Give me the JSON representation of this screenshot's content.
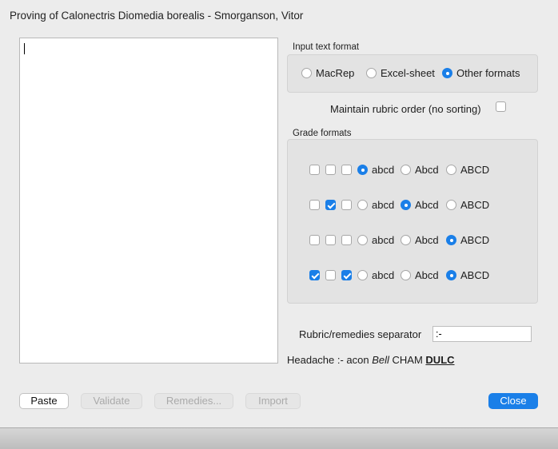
{
  "window": {
    "title": "Proving of Calonectris Diomedia borealis - Smorganson, Vitor"
  },
  "input_text_format": {
    "label": "Input text format",
    "options": [
      {
        "label": "MacRep",
        "selected": false
      },
      {
        "label": "Excel-sheet",
        "selected": false
      },
      {
        "label": "Other formats",
        "selected": true
      }
    ]
  },
  "maintain_rubric_order": {
    "label": "Maintain rubric order (no sorting)",
    "checked": false
  },
  "grade_formats": {
    "label": "Grade formats",
    "rows": [
      {
        "checks": [
          false,
          false,
          false
        ],
        "choices": [
          "abcd",
          "Abcd",
          "ABCD"
        ],
        "selected": 0
      },
      {
        "checks": [
          false,
          true,
          false
        ],
        "choices": [
          "abcd",
          "Abcd",
          "ABCD"
        ],
        "selected": 1
      },
      {
        "checks": [
          false,
          false,
          false
        ],
        "choices": [
          "abcd",
          "Abcd",
          "ABCD"
        ],
        "selected": 2
      },
      {
        "checks": [
          true,
          false,
          true
        ],
        "choices": [
          "abcd",
          "Abcd",
          "ABCD"
        ],
        "selected": 2
      }
    ]
  },
  "separator": {
    "label": "Rubric/remedies separator",
    "value": ":-"
  },
  "example": {
    "prefix": "Headache :- acon ",
    "italic": "Bell",
    "middle": " CHAM ",
    "bold_underline": "DULC"
  },
  "buttons": {
    "paste": "Paste",
    "validate": "Validate",
    "remedies": "Remedies...",
    "import": "Import",
    "close": "Close"
  },
  "colors": {
    "accent": "#1a7fe8"
  }
}
